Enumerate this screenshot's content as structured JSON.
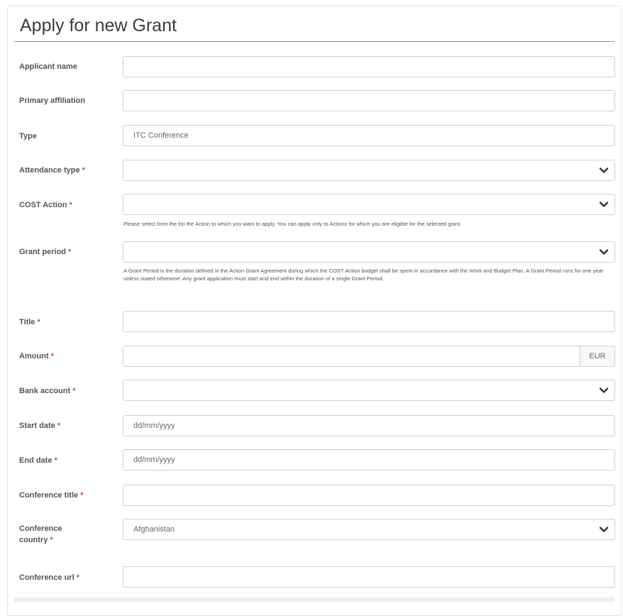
{
  "page": {
    "title": "Apply for new Grant"
  },
  "form": {
    "applicant_name": {
      "label": "Applicant name",
      "value": ""
    },
    "primary_affiliation": {
      "label": "Primary affiliation",
      "value": ""
    },
    "type": {
      "label": "Type",
      "value": "ITC Conference"
    },
    "attendance_type": {
      "label": "Attendance type",
      "value": ""
    },
    "cost_action": {
      "label": "COST Action",
      "value": "",
      "help": "Please select from the list the Action to which you want to apply. You can apply only to Actions for which you are eligible for the selected grant."
    },
    "grant_period": {
      "label": "Grant period",
      "value": "",
      "help": "A Grant Period is the duration defined in the Action Grant Agreement during which the COST Action budget shall be spent in accordance with the Work and Budget Plan. A Grant Period runs for one year unless stated otherwise. Any grant application must start and end within the duration of a single Grant Period."
    },
    "title": {
      "label": "Title",
      "value": ""
    },
    "amount": {
      "label": "Amount",
      "value": "",
      "currency": "EUR"
    },
    "bank_account": {
      "label": "Bank account",
      "value": ""
    },
    "start_date": {
      "label": "Start date",
      "placeholder": "dd/mm/yyyy"
    },
    "end_date": {
      "label": "End date",
      "placeholder": "dd/mm/yyyy"
    },
    "conference_title": {
      "label": "Conference title",
      "value": ""
    },
    "conference_country": {
      "label_line1": "Conference",
      "label_line2": "country",
      "value": "Afghanistan"
    },
    "conference_url": {
      "label": "Conference url",
      "value": ""
    },
    "required_marker": "*"
  },
  "colors": {
    "required": "#d04a4a",
    "title_rule": "#8a8fb5",
    "border": "#cfd0d4"
  },
  "icons": {
    "select_arrow": "chevron-down-icon"
  }
}
